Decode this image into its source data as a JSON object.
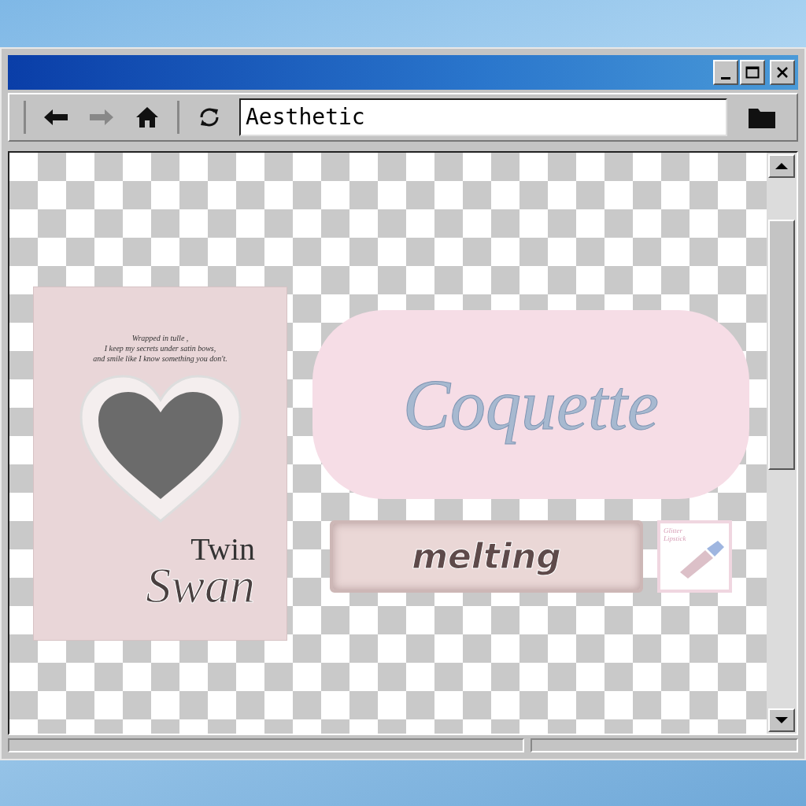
{
  "address_bar": {
    "value": "Aesthetic"
  },
  "poster": {
    "quote": [
      "Wrapped in tulle ,",
      "I keep my secrets under satin bows,",
      "and smile like I know something you don't."
    ],
    "title_top": "Twin",
    "title_main": "Swan"
  },
  "coquette_sticker": {
    "text": "Coquette"
  },
  "melting_sticker": {
    "text": "melting"
  },
  "lipstick_card": {
    "text": "Glitter Lipstick"
  }
}
